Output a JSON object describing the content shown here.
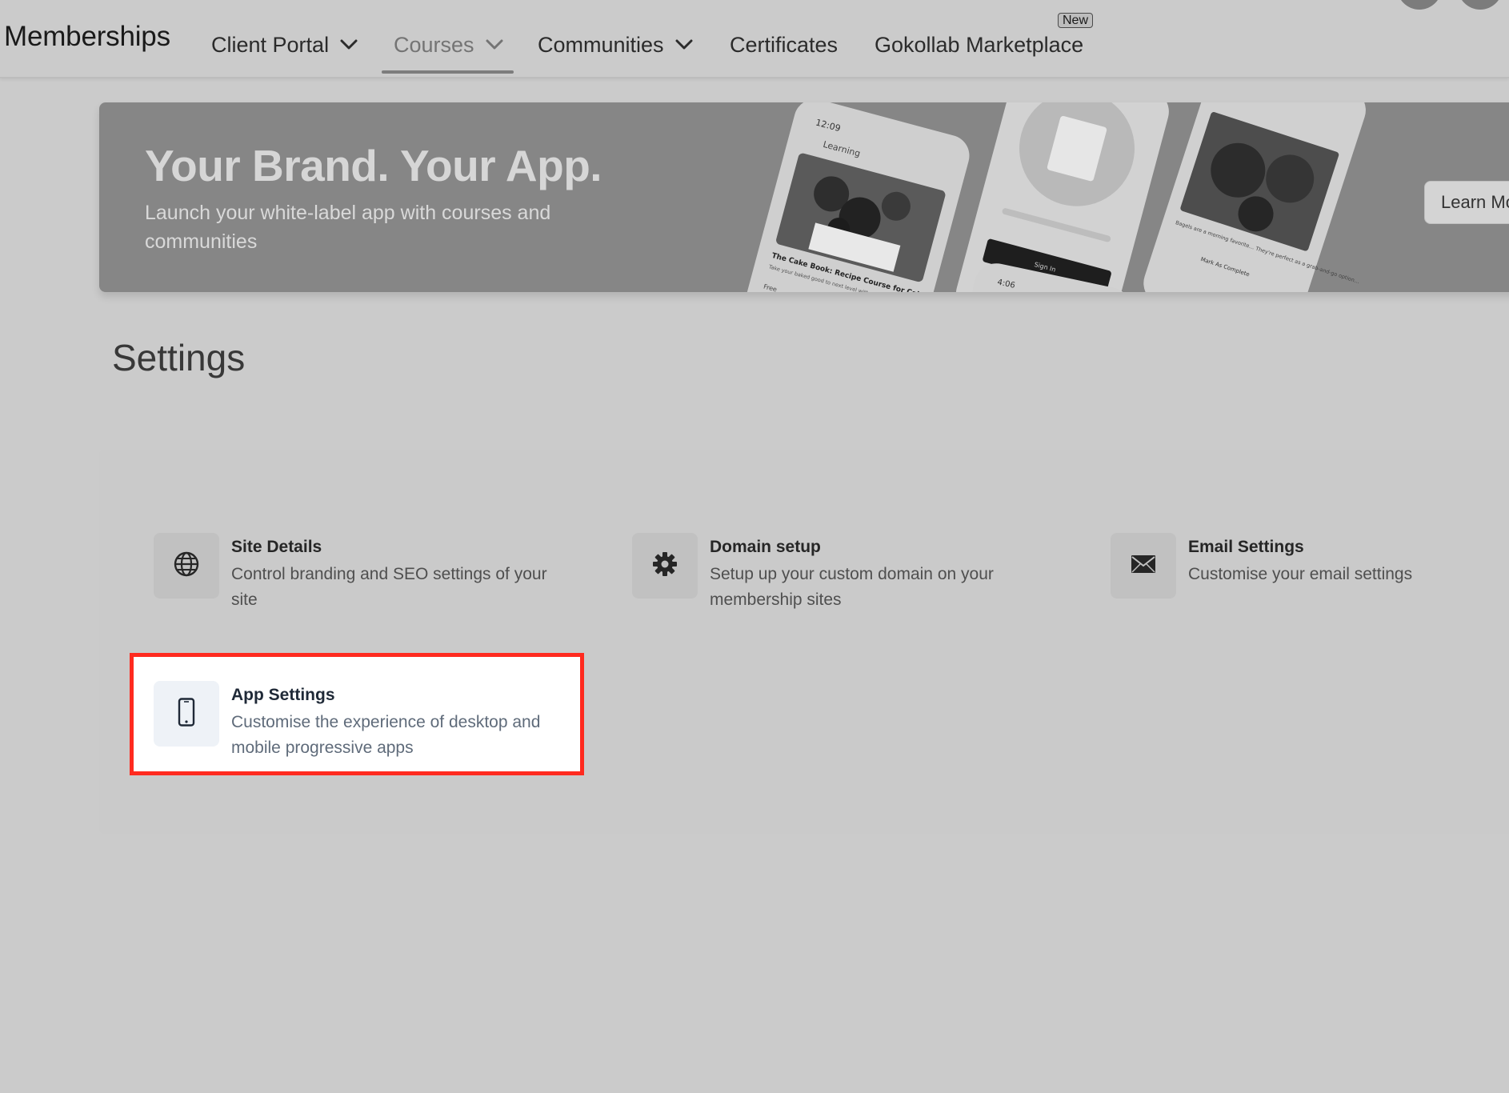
{
  "nav": {
    "brand": "Memberships",
    "items": [
      {
        "label": "Client Portal",
        "dropdown": true
      },
      {
        "label": "Courses",
        "dropdown": true,
        "active": true
      },
      {
        "label": "Communities",
        "dropdown": true
      },
      {
        "label": "Certificates",
        "dropdown": false
      },
      {
        "label": "Gokollab Marketplace",
        "dropdown": false,
        "badge": "New"
      }
    ]
  },
  "banner": {
    "title": "Your Brand. Your App.",
    "subtitle": "Launch your white-label app with courses and communities",
    "learn_more": "Learn More",
    "phone1": {
      "time": "12:09",
      "screen": "Learning",
      "course_title": "The Cake Book: Recipe Course for Cakes",
      "course_desc": "Take your baked good to next level with the decadent buttercreams, meringues, ganache and more.",
      "price": "Free"
    },
    "phone2": {
      "button": "Sign In"
    },
    "phone3": {
      "caption": "Bagels are a morning favorite… They're perfect as a grab-and-go option…",
      "action": "Mark As Complete"
    },
    "phone4": {
      "time": "4:06"
    }
  },
  "settings": {
    "title": "Settings",
    "cards": [
      {
        "title": "Site Details",
        "desc": "Control branding and SEO settings of your site",
        "icon": "globe-icon"
      },
      {
        "title": "Domain setup",
        "desc": "Setup up your custom domain on your membership sites",
        "icon": "gear-icon"
      },
      {
        "title": "Email Settings",
        "desc": "Customise your email settings",
        "icon": "envelope-icon"
      },
      {
        "title": "App Settings",
        "desc": "Customise the experience of desktop and mobile progressive apps",
        "icon": "mobile-phone-icon",
        "highlighted": true
      }
    ]
  },
  "colors": {
    "overlay": "#cbcbcb",
    "highlight_border": "#ff2a1f",
    "highlight_bg": "#ffffff"
  }
}
